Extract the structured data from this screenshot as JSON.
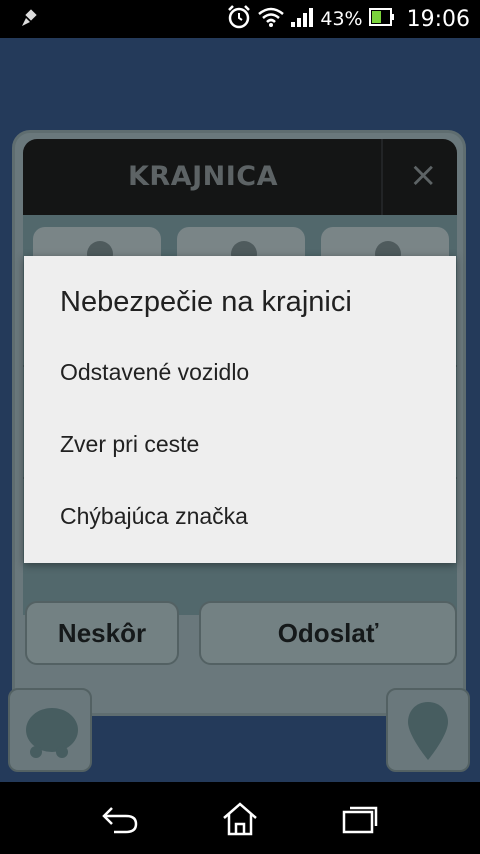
{
  "status_bar": {
    "battery_percent": "43%",
    "time": "19:06",
    "icons": [
      "notification-icon",
      "alarm-icon",
      "wifi-icon",
      "signal-icon",
      "battery-icon"
    ]
  },
  "report_card": {
    "title": "KRAJNICA",
    "close_label": "×",
    "later_button": "Neskôr",
    "send_button": "Odoslať"
  },
  "dialog": {
    "title": "Nebezpečie na krajnici",
    "options": [
      {
        "label": "Odstavené vozidlo"
      },
      {
        "label": "Zver pri ceste"
      },
      {
        "label": "Chýbajúca značka"
      }
    ]
  },
  "colors": {
    "app_background": "#314e78",
    "dialog_background": "#eeeeee",
    "header_background": "#1b1c1d"
  },
  "nav_icons": [
    "back-icon",
    "home-icon",
    "recent-apps-icon"
  ]
}
